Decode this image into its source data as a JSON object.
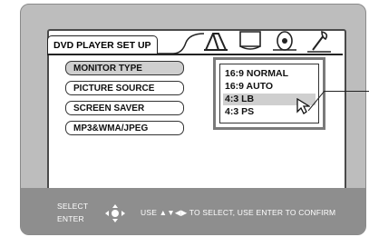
{
  "setup_menu": {
    "title": "DVD PLAYER SET UP",
    "items": [
      {
        "label": "MONITOR TYPE",
        "selected": true
      },
      {
        "label": "PICTURE SOURCE",
        "selected": false
      },
      {
        "label": "SCREEN SAVER",
        "selected": false
      },
      {
        "label": "MP3&WMA/JPEG",
        "selected": false
      }
    ],
    "tab_icons": [
      "wrench-icon",
      "monitor-icon",
      "speaker-icon",
      "settings-icon"
    ]
  },
  "monitor_dropdown": {
    "options": [
      {
        "label": "16:9 NORMAL",
        "highlighted": false
      },
      {
        "label": "16:9 AUTO",
        "highlighted": false
      },
      {
        "label": "4:3 LB",
        "highlighted": true
      },
      {
        "label": "4:3 PS",
        "highlighted": false
      }
    ],
    "cursor_icon": "pointer-icon"
  },
  "footer": {
    "select_label": "SELECT",
    "enter_label": "ENTER",
    "instruction": "USE ▲▼◀▶ TO SELECT, USE ENTER TO CONFIRM",
    "control_icon": "direction-pad-icon"
  }
}
